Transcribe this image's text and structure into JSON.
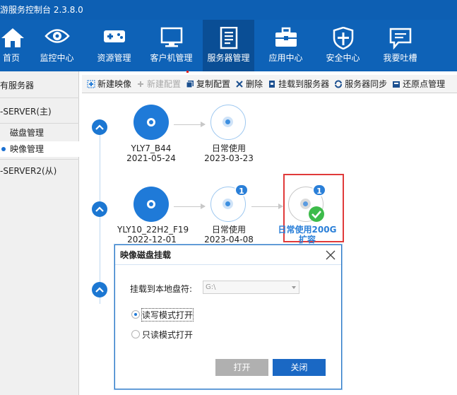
{
  "app": {
    "title": "游服务控制台 2.3.8.0"
  },
  "nav": {
    "items": [
      {
        "label": "首页",
        "icon": "home-icon"
      },
      {
        "label": "监控中心",
        "icon": "eye-icon"
      },
      {
        "label": "资源管理",
        "icon": "gamepad-icon"
      },
      {
        "label": "客户机管理",
        "icon": "monitor-icon"
      },
      {
        "label": "服务器管理",
        "icon": "server-document-icon",
        "active": true
      },
      {
        "label": "应用中心",
        "icon": "toolbox-icon"
      },
      {
        "label": "安全中心",
        "icon": "shield-icon"
      },
      {
        "label": "我要吐槽",
        "icon": "feedback-icon"
      }
    ]
  },
  "sidebar": {
    "header": "有服务器",
    "server1": "-SERVER(主)",
    "disk_mgmt": "磁盘管理",
    "image_mgmt": "映像管理",
    "server2": "-SERVER2(从)"
  },
  "toolbar": {
    "new_image": "新建映像",
    "new_config": "新建配置",
    "copy_config": "复制配置",
    "delete": "删除",
    "mount": "挂载到服务器",
    "sync": "服务器同步",
    "restore": "还原点管理"
  },
  "images": [
    {
      "name": "YLY7_B44",
      "date": "2021-05-24",
      "child": {
        "name": "日常使用",
        "date": "2023-03-23"
      }
    },
    {
      "name": "YLY10_22H2_F19",
      "date": "2022-12-01",
      "child": {
        "name": "日常使用",
        "date": "2023-04-08",
        "badge": "1"
      },
      "grandchild": {
        "name": "日常使用200G扩容",
        "badge": "1"
      }
    }
  ],
  "dialog": {
    "title": "映像磁盘挂载",
    "drive_label": "挂载到本地盘符:",
    "drive_value": "G:\\",
    "mode_rw": "读写模式打开",
    "mode_ro": "只读模式打开",
    "open_button": "打开",
    "close_button": "关闭"
  },
  "colors": {
    "nav_bg": "#0e62b7",
    "nav_active": "#0a4e95",
    "accent": "#1f7ad8",
    "success": "#3dbb4a",
    "selection": "#e03a3a"
  }
}
